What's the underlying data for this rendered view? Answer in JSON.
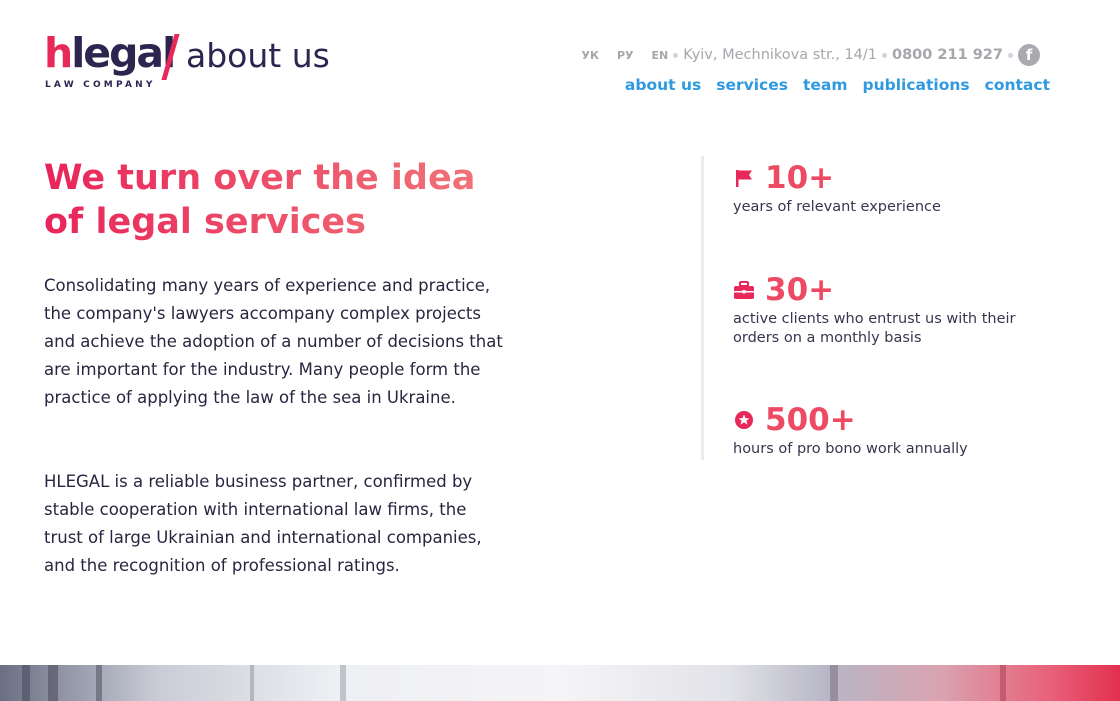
{
  "brand": {
    "logo_h": "h",
    "logo_legal": "legal",
    "page_label": "about us",
    "subtitle": "LAW COMPANY",
    "accent_color": "#e8285a",
    "dark_color": "#2d2550"
  },
  "topbar": {
    "languages": [
      "УК",
      "РУ",
      "EN"
    ],
    "address": "Kyiv, Mechnikova str., 14/1",
    "phone": "0800 211 927",
    "social_icon": "facebook-icon",
    "social_glyph": "f"
  },
  "nav": {
    "items": [
      "about us",
      "services",
      "team",
      "publications",
      "contact"
    ],
    "link_color": "#2f9ae0"
  },
  "main": {
    "headline": "We turn over the idea of legal services",
    "paragraph_1": "Consolidating many years of experience and practice, the company's lawyers accompany complex projects and achieve the adoption of a number of decisions that are important for the industry. Many people form the practice of applying the law of the sea in Ukraine.",
    "paragraph_2": "HLEGAL is a reliable business partner, confirmed by stable cooperation with international law firms, the trust of large Ukrainian and international companies, and the recognition of professional ratings."
  },
  "stats": [
    {
      "icon": "flag-icon",
      "value": "10+",
      "text": "years of relevant experience"
    },
    {
      "icon": "briefcase-icon",
      "value": "30+",
      "text": "active clients who entrust us with their orders on a monthly basis"
    },
    {
      "icon": "star-badge-icon",
      "value": "500+",
      "text": "hours of pro bono work annually"
    }
  ]
}
